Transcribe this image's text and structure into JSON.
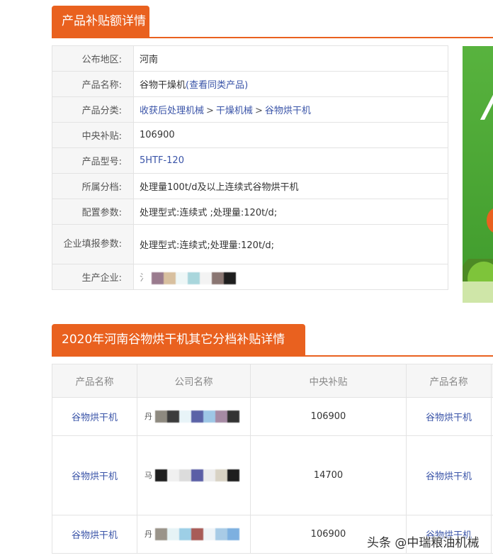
{
  "section1": {
    "title": "产品补贴额详情"
  },
  "detail": {
    "region": {
      "label": "公布地区:",
      "value": "河南"
    },
    "product_name": {
      "label": "产品名称:",
      "value": "谷物干燥机",
      "link": "(查看同类产品)"
    },
    "category": {
      "label": "产品分类:",
      "parts": [
        "收获后处理机械",
        "干燥机械",
        "谷物烘干机"
      ],
      "sep": ">"
    },
    "subsidy": {
      "label": "中央补贴:",
      "value": "106900"
    },
    "model": {
      "label": "产品型号:",
      "value": "5HTF-120"
    },
    "tier": {
      "label": "所属分档:",
      "value": "处理量100t/d及以上连续式谷物烘干机"
    },
    "config": {
      "label": "配置参数:",
      "value": "处理型式:连续式 ;处理量:120t/d;"
    },
    "filed": {
      "label": "企业填报参数:",
      "value": "处理型式:连续式;处理量:120t/d;"
    },
    "maker": {
      "label": "生产企业:",
      "value_prefix": "氵"
    }
  },
  "section2": {
    "title": "2020年河南谷物烘干机其它分档补贴详情"
  },
  "other_table": {
    "headers": [
      "产品名称",
      "公司名称",
      "中央补贴",
      "产品名称"
    ],
    "rows": [
      {
        "product": "谷物烘干机",
        "company_prefix": "丹",
        "subsidy": "106900",
        "product2": "谷物烘干机"
      },
      {
        "product": "谷物烘干机",
        "company_prefix": "马",
        "subsidy": "14700",
        "product2": "谷物烘干机"
      },
      {
        "product": "谷物烘干机",
        "company_prefix": "丹",
        "subsidy": "106900",
        "product2": "谷物烘干机"
      }
    ]
  },
  "watermark": "头条 @中瑞粮油机械",
  "colors": {
    "accent": "#e9611f",
    "link": "#3a54a8"
  }
}
